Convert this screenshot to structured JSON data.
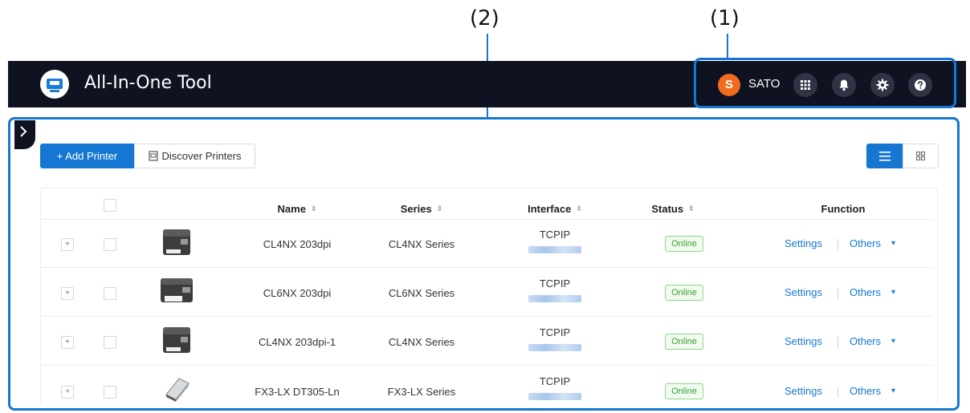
{
  "callouts": {
    "one": "(1)",
    "two": "(2)"
  },
  "app": {
    "title": "All-In-One Tool",
    "icon": "printer-monitor-icon"
  },
  "user": {
    "initial": "S",
    "name": "SATO",
    "avatar_color": "#f26c1f"
  },
  "header_buttons": [
    "apps-grid-icon",
    "bell-icon",
    "gear-icon",
    "help-icon"
  ],
  "toolbar": {
    "add_label": "+ Add Printer",
    "discover_label": "Discover Printers",
    "view_modes": [
      "list",
      "grid"
    ],
    "active_view": "list"
  },
  "table": {
    "columns": [
      "Name",
      "Series",
      "Interface",
      "Status",
      "Function"
    ],
    "rows": [
      {
        "name": "CL4NX 203dpi",
        "series": "CL4NX Series",
        "interface": "TCPIP",
        "status": "Online",
        "settings": "Settings",
        "others": "Others"
      },
      {
        "name": "CL6NX 203dpi",
        "series": "CL6NX Series",
        "interface": "TCPIP",
        "status": "Online",
        "settings": "Settings",
        "others": "Others"
      },
      {
        "name": "CL4NX 203dpi-1",
        "series": "CL4NX Series",
        "interface": "TCPIP",
        "status": "Online",
        "settings": "Settings",
        "others": "Others"
      },
      {
        "name": "FX3-LX DT305-Ln",
        "series": "FX3-LX Series",
        "interface": "TCPIP",
        "status": "Online",
        "settings": "Settings",
        "others": "Others"
      }
    ]
  },
  "colors": {
    "accent": "#1677d2",
    "header_bg": "#0f1220",
    "online_green": "#3aa03a"
  }
}
